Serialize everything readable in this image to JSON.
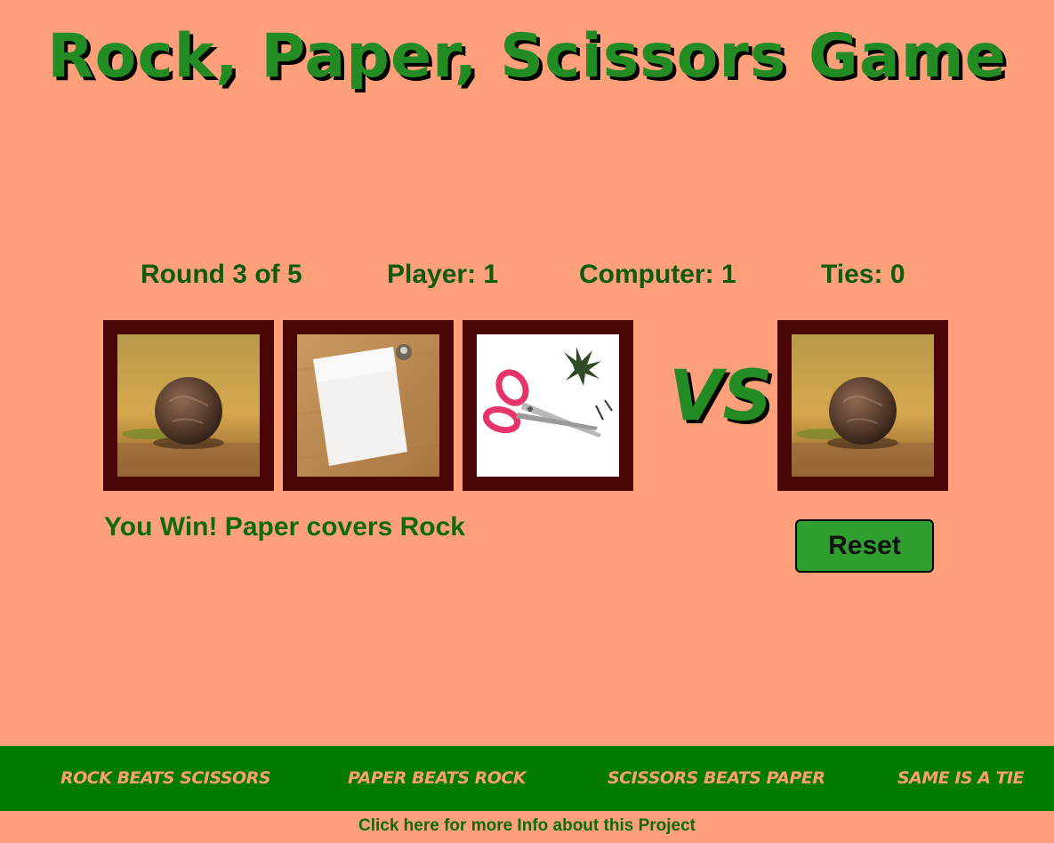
{
  "header": {
    "title": "Rock, Paper, Scissors Game"
  },
  "scoreboard": {
    "round": "Round 3 of 5",
    "player": "Player: 1",
    "computer": "Computer: 1",
    "ties": "Ties: 0"
  },
  "choices": [
    {
      "name": "rock",
      "icon": "rock-image"
    },
    {
      "name": "paper",
      "icon": "paper-image"
    },
    {
      "name": "scissors",
      "icon": "scissors-image"
    }
  ],
  "vs_label": "VS",
  "computer_choice": {
    "name": "rock",
    "icon": "rock-image"
  },
  "result_text": "You Win! Paper covers Rock",
  "reset_label": "Reset",
  "rules": [
    "ROCK BEATS SCISSORS",
    "PAPER BEATS ROCK",
    "SCISSORS BEATS PAPER",
    "SAME IS A TIE"
  ],
  "info_link": "Click here for more Info about this Project",
  "colors": {
    "background": "#ffa07a",
    "accent_green": "#228b22",
    "card_frame": "#4a0606",
    "footer_bar": "#007a00"
  }
}
